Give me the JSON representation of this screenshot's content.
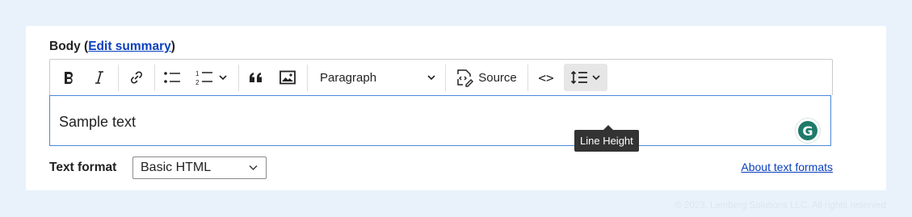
{
  "field": {
    "label": "Body",
    "open_paren": " (",
    "edit_summary_link": "Edit summary",
    "close_paren": ")"
  },
  "toolbar": {
    "paragraph_label": "Paragraph",
    "source_label": "Source",
    "code_label": "<>",
    "tooltip": "Line Height"
  },
  "editor": {
    "content": "Sample text",
    "grammarly_letter": "G"
  },
  "text_format": {
    "label": "Text format",
    "selected": "Basic HTML",
    "about_link": "About text formats"
  },
  "footer": {
    "copyright": "© 2023, Lemberg Solutions LLC. All rights reserved"
  },
  "colors": {
    "background": "#e9f1fb",
    "link": "#0a3fbd",
    "focus_border": "#4c88d8",
    "tooltip_bg": "#333333"
  }
}
